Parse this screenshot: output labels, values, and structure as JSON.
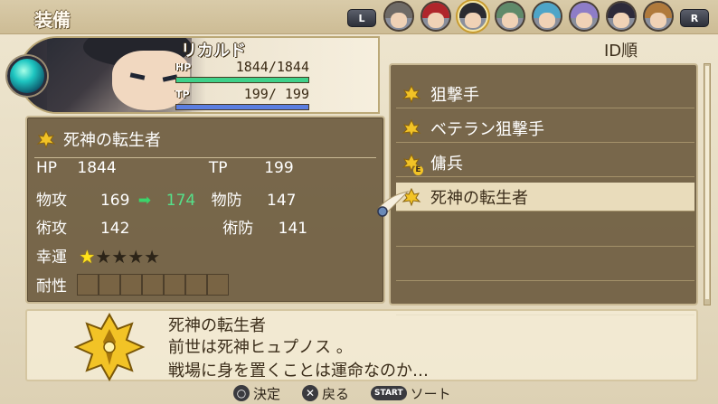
{
  "header": {
    "title": "装備",
    "left_shoulder": "L",
    "right_shoulder": "R",
    "party_portraits": [
      {
        "icon": "party-member-1-portrait",
        "hair": "#6e6a66",
        "active": false
      },
      {
        "icon": "party-member-2-portrait",
        "hair": "#b0262b",
        "active": false
      },
      {
        "icon": "party-member-3-portrait",
        "hair": "#2a2a30",
        "active": true
      },
      {
        "icon": "party-member-4-portrait",
        "hair": "#5f8a6a",
        "active": false
      },
      {
        "icon": "party-member-5-portrait",
        "hair": "#4ea5c8",
        "active": false
      },
      {
        "icon": "party-member-6-portrait",
        "hair": "#8e7dc7",
        "active": false
      },
      {
        "icon": "party-member-7-portrait",
        "hair": "#2d2a3a",
        "active": false
      },
      {
        "icon": "party-member-8-portrait",
        "hair": "#b07a3c",
        "active": false
      }
    ]
  },
  "character": {
    "name": "リカルド",
    "hp_label": "HP",
    "hp_value": "1844/1844",
    "hp_fraction": 1.0,
    "tp_label": "TP",
    "tp_value": "199/ 199",
    "tp_fraction": 1.0
  },
  "stats": {
    "title_name": "死神の転生者",
    "hp_label": "HP",
    "hp": "1844",
    "tp_label": "TP",
    "tp": "199",
    "patk_label": "物攻",
    "patk": "169",
    "patk_new": "174",
    "pdef_label": "物防",
    "pdef": "147",
    "matk_label": "術攻",
    "matk": "142",
    "mdef_label": "術防",
    "mdef": "141",
    "luck_label": "幸運",
    "luck_stars": 1,
    "luck_max": 5,
    "resist_label": "耐性",
    "resist_icons": [
      "fire-resist-icon",
      "water-resist-icon",
      "earth-resist-icon",
      "wind-resist-icon",
      "thunder-resist-icon",
      "light-resist-icon",
      "dark-resist-icon"
    ]
  },
  "list": {
    "sort_label": "ID順",
    "items": [
      {
        "label": "狙撃手",
        "selected": false,
        "equipped": false
      },
      {
        "label": "ベテラン狙撃手",
        "selected": false,
        "equipped": false
      },
      {
        "label": "傭兵",
        "selected": false,
        "equipped": true,
        "equipped_mark": "E"
      },
      {
        "label": "死神の転生者",
        "selected": true,
        "equipped": false
      }
    ]
  },
  "description": {
    "title": "死神の転生者",
    "line1": "前世は死神ヒュプノス 。",
    "line2": "戦場に身を置くことは運命なのか…"
  },
  "controls": {
    "confirm_glyph": "○",
    "confirm_label": "決定",
    "back_glyph": "✕",
    "back_label": "戻る",
    "sort_glyph": "START",
    "sort_label": "ソート"
  },
  "colors": {
    "hp_bar": "#3fd18a",
    "tp_bar": "#5b7ee0",
    "emblem": "#f2c326",
    "star_on": "#ffe31a"
  }
}
